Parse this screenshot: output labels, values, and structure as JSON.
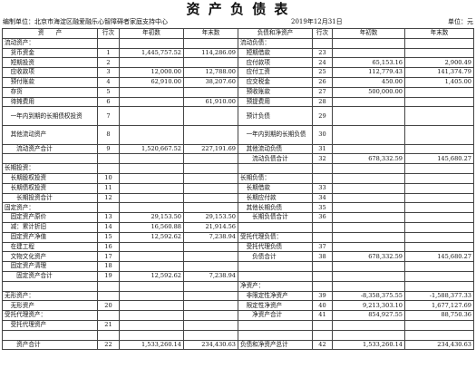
{
  "title": "资 产 负 债 表",
  "meta": {
    "unit_label": "编制单位：北京市海淀区融爱融乐心智障碍者家庭支持中心",
    "date": "2019年12月31日",
    "currency": "单位：元"
  },
  "headers": [
    "资　　产",
    "行次",
    "年初数",
    "年末数",
    "负债和净资产",
    "行次",
    "年初数",
    "年末数"
  ],
  "rows": [
    [
      "流动资产：",
      "",
      "",
      "",
      "流动负债：",
      "",
      "",
      ""
    ],
    [
      "　货币资金",
      "1",
      "1,445,757.52",
      "114,286.09",
      "　短期借款",
      "23",
      "",
      ""
    ],
    [
      "　短期投资",
      "2",
      "",
      "",
      "　应付款项",
      "24",
      "65,153.16",
      "2,900.49"
    ],
    [
      "　应收款项",
      "3",
      "12,000.00",
      "12,788.00",
      "　应付工资",
      "25",
      "112,779.43",
      "141,374.79"
    ],
    [
      "　预付账款",
      "4",
      "62,910.00",
      "38,207.60",
      "　应交税金",
      "26",
      "450.00",
      "1,405.00"
    ],
    [
      "　存货",
      "5",
      "",
      "",
      "　预收账款",
      "27",
      "500,000.00",
      ""
    ],
    [
      "　待摊费用",
      "6",
      "",
      "61,910.00",
      "　预提费用",
      "28",
      "",
      ""
    ],
    [
      "　一年内到期的长期债权投资",
      "7",
      "",
      "",
      "　预计负债",
      "29",
      "",
      ""
    ],
    [
      "　其他流动资产",
      "8",
      "",
      "",
      "　一年内到期的长期负债",
      "30",
      "",
      ""
    ],
    [
      "　　流动资产合计",
      "9",
      "1,520,667.52",
      "227,191.69",
      "　其他流动负债",
      "31",
      "",
      ""
    ],
    [
      "",
      "",
      "",
      "",
      "　　流动负债合计",
      "32",
      "678,332.59",
      "145,680.27"
    ],
    [
      "长期投资：",
      "",
      "",
      "",
      "",
      "",
      "",
      ""
    ],
    [
      "　长期股权投资",
      "10",
      "",
      "",
      "长期负债：",
      "",
      "",
      ""
    ],
    [
      "　长期债权投资",
      "11",
      "",
      "",
      "　长期借款",
      "33",
      "",
      ""
    ],
    [
      "　　长期投资合计",
      "12",
      "",
      "",
      "　长期应付款",
      "34",
      "",
      ""
    ],
    [
      "固定资产：",
      "",
      "",
      "",
      "　其他长期负债",
      "35",
      "",
      ""
    ],
    [
      "　固定资产原价",
      "13",
      "29,153.50",
      "29,153.50",
      "　　长期负债合计",
      "36",
      "",
      ""
    ],
    [
      "　减：累计折旧",
      "14",
      "16,560.88",
      "21,914.56",
      "",
      "",
      "",
      ""
    ],
    [
      "　固定资产净值",
      "15",
      "12,592.62",
      "7,238.94",
      "受托代理负债：",
      "",
      "",
      ""
    ],
    [
      "　在建工程",
      "16",
      "",
      "",
      "　受托代理负债",
      "37",
      "",
      ""
    ],
    [
      "　文物文化资产",
      "17",
      "",
      "",
      "　　负债合计",
      "38",
      "678,332.59",
      "145,680.27"
    ],
    [
      "　固定资产清理",
      "18",
      "",
      "",
      "",
      "",
      "",
      ""
    ],
    [
      "　　固定资产合计",
      "19",
      "12,592.62",
      "7,238.94",
      "",
      "",
      "",
      ""
    ],
    [
      "",
      "",
      "",
      "",
      "净资产：",
      "",
      "",
      ""
    ],
    [
      "无形资产：",
      "",
      "",
      "",
      "　非限定性净资产",
      "39",
      "-8,358,375.55",
      "-1,588,377.33"
    ],
    [
      "　无形资产",
      "20",
      "",
      "",
      "　限定性净资产",
      "40",
      "9,213,303.10",
      "1,677,127.69"
    ],
    [
      "受托代理资产：",
      "",
      "",
      "",
      "　　净资产合计",
      "41",
      "854,927.55",
      "88,750.36"
    ],
    [
      "　受托代理资产",
      "21",
      "",
      "",
      "",
      "",
      "",
      ""
    ],
    [
      "",
      "",
      "",
      "",
      "",
      "",
      "",
      ""
    ],
    [
      "　　资产合计",
      "22",
      "1,533,260.14",
      "234,430.63",
      "负债和净资产总计",
      "42",
      "1,533,260.14",
      "234,430.63"
    ]
  ]
}
